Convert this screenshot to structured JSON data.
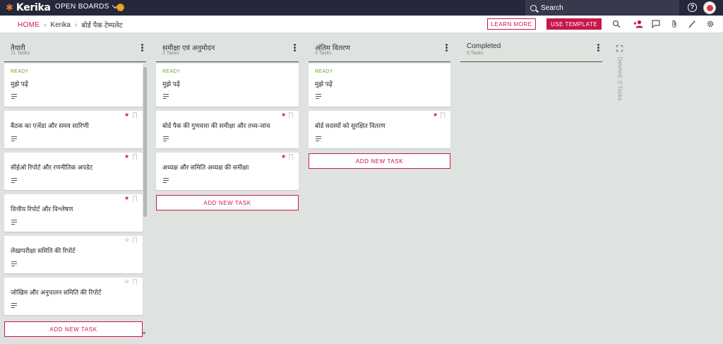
{
  "app": {
    "name": "Kerika",
    "open_boards_label": "OPEN BOARDS"
  },
  "search": {
    "placeholder": "Search"
  },
  "help_label": "?",
  "breadcrumb": {
    "home": "HOME",
    "org": "Kerika",
    "board": "बोर्ड पैक टेम्पलेट"
  },
  "actions": {
    "learn_more": "LEARN MORE",
    "use_template": "USE TEMPLATE"
  },
  "toolbar_icons": [
    "search-icon",
    "add-person-icon",
    "chat-icon",
    "attachment-icon",
    "magic-wand-icon",
    "gear-icon"
  ],
  "colors": {
    "accent": "#c8184a",
    "ready": "#6aa72a",
    "topbar": "#24283a",
    "board_bg": "#dfe3df"
  },
  "columns": [
    {
      "title": "तैयारी",
      "count": "11 Tasks",
      "cards": [
        {
          "ready": "READY",
          "title": "मुझे पढ़ें"
        },
        {
          "title": "बैठक का एजेंडा और समय सारिणी",
          "star": "★"
        },
        {
          "title": "सीईओ रिपोर्ट और रणनीतिक अपडेट",
          "star": "★"
        },
        {
          "title": "वित्तीय रिपोर्ट और विश्लेषण",
          "star": "★"
        },
        {
          "title": "लेखापरीक्षा समिति की रिपोर्ट",
          "star": "☆"
        },
        {
          "title": "जोखिम और अनुपालन समिति की रिपोर्ट",
          "star": "☆"
        }
      ],
      "add_task": "ADD NEW TASK"
    },
    {
      "title": "समीक्षा एवं अनुमोदन",
      "count": "3 Tasks",
      "cards": [
        {
          "ready": "READY",
          "title": "मुझे पढ़ें"
        },
        {
          "title": "बोर्ड पैक की गुणवत्ता की समीक्षा और तथ्य-जांच",
          "star": "★"
        },
        {
          "title": "अध्यक्ष और समिति अध्यक्ष की समीक्षा",
          "star": "★"
        }
      ],
      "add_task": "ADD NEW TASK"
    },
    {
      "title": "अंतिम वितरण",
      "count": "2 Tasks",
      "cards": [
        {
          "ready": "READY",
          "title": "मुझे पढ़ें"
        },
        {
          "title": "बोर्ड सदस्यों को सुरक्षित वितरण",
          "star": "★"
        }
      ],
      "add_task": "ADD NEW TASK"
    },
    {
      "title": "Completed",
      "count": "0 Tasks",
      "cards": []
    }
  ],
  "deleted": "Deleted: 0 Tasks"
}
